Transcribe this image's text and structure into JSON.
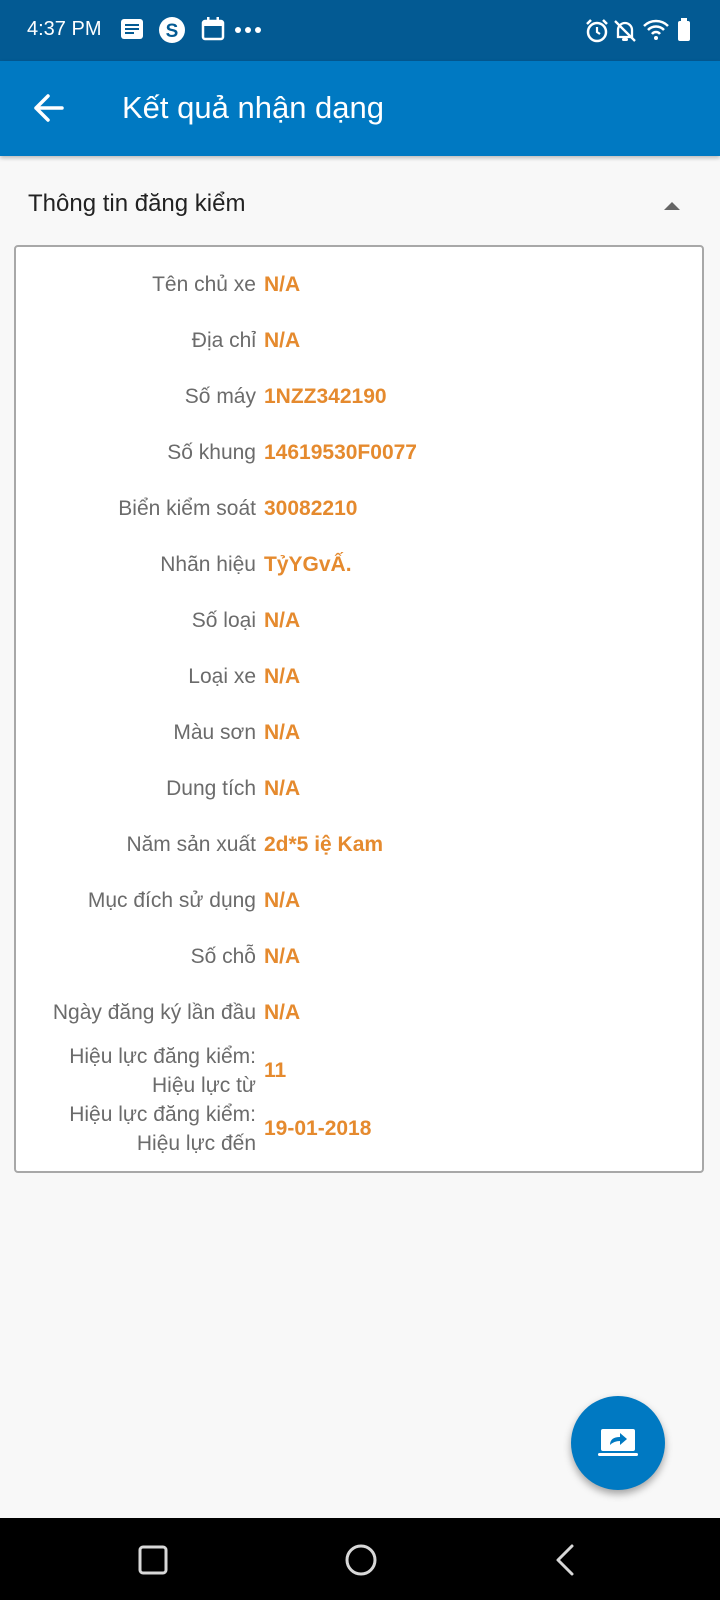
{
  "status_bar": {
    "time": "4:37 PM",
    "left_icons": [
      "notes-icon",
      "skype-icon",
      "calendar-icon",
      "more-dots-icon"
    ],
    "right_icons": [
      "alarm-icon",
      "notifications-off-icon",
      "wifi-icon",
      "battery-icon"
    ]
  },
  "app_bar": {
    "title": "Kết quả nhận dạng",
    "back_icon": "arrow-left-icon",
    "background": "#0079c2"
  },
  "section": {
    "title": "Thông tin đăng kiểm",
    "toggle_icon": "caret-up-icon"
  },
  "fields": [
    {
      "label": "Tên chủ xe",
      "value": "N/A"
    },
    {
      "label": "Địa chỉ",
      "value": "N/A"
    },
    {
      "label": "Số máy",
      "value": "1NZZ342190"
    },
    {
      "label": "Số khung",
      "value": "14619530F0077"
    },
    {
      "label": "Biển kiểm soát",
      "value": "30082210"
    },
    {
      "label": "Nhãn hiệu",
      "value": "TỷYGvẤ."
    },
    {
      "label": "Số loại",
      "value": "N/A"
    },
    {
      "label": "Loại xe",
      "value": "N/A"
    },
    {
      "label": "Màu sơn",
      "value": "N/A"
    },
    {
      "label": "Dung tích",
      "value": "N/A"
    },
    {
      "label": "Năm sản xuất",
      "value": "2d*5 iệ Kam"
    },
    {
      "label": "Mục đích sử dụng",
      "value": "N/A"
    },
    {
      "label": "Số chỗ",
      "value": "N/A"
    },
    {
      "label": "Ngày đăng ký lần đầu",
      "value": "N/A"
    },
    {
      "label_line1": "Hiệu lực đăng kiểm:",
      "label_line2": "Hiệu lực từ",
      "value": "11"
    },
    {
      "label_line1": "Hiệu lực đăng kiểm:",
      "label_line2": "Hiệu lực đến",
      "value": "19-01-2018"
    }
  ],
  "fab": {
    "icon": "share-screen-icon"
  },
  "nav_bar": {
    "icons": [
      "recents-square-icon",
      "home-circle-icon",
      "back-chevron-icon"
    ]
  },
  "colors": {
    "value_text": "#e58a2e",
    "label_text": "#6b6b6b",
    "status_bar": "#035a93"
  }
}
